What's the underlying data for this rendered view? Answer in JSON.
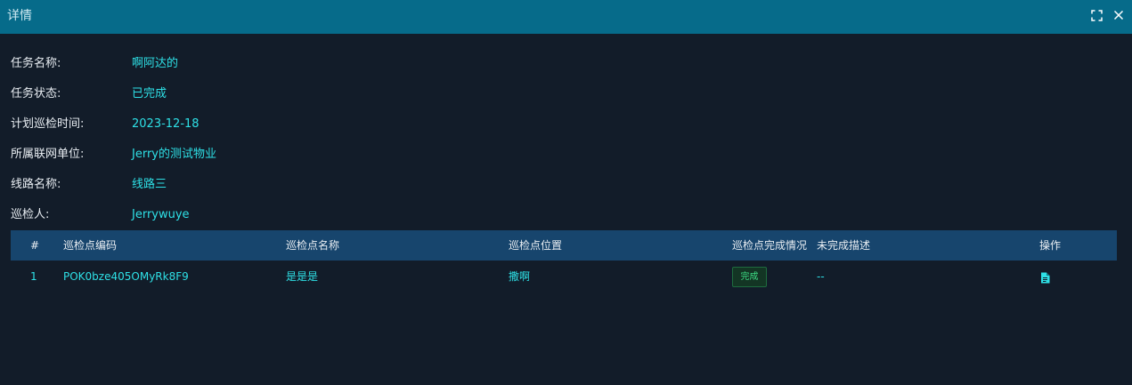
{
  "window": {
    "title": "详情",
    "icons": {
      "fullscreen": "fullscreen-icon",
      "close": "close-icon"
    }
  },
  "fields": [
    {
      "label": "任务名称:",
      "value": "啊阿达的"
    },
    {
      "label": "任务状态:",
      "value": "已完成"
    },
    {
      "label": "计划巡检时间:",
      "value": "2023-12-18"
    },
    {
      "label": "所属联网单位:",
      "value": "Jerry的测试物业"
    },
    {
      "label": "线路名称:",
      "value": "线路三"
    },
    {
      "label": "巡检人:",
      "value": "Jerrywuye"
    }
  ],
  "table": {
    "headers": [
      "#",
      "巡检点编码",
      "巡检点名称",
      "巡检点位置",
      "巡检点完成情况",
      "未完成描述",
      "操作"
    ],
    "rows": [
      {
        "index": "1",
        "code": "POK0bze405OMyRk8F9",
        "name": "是是是",
        "position": "撒啊",
        "status": "完成",
        "description": "--",
        "action_icon": "document-icon"
      }
    ]
  },
  "colors": {
    "titlebar": "#066b8a",
    "background": "#121c29",
    "table_header": "#17456d",
    "accent_text": "#2ee0e6",
    "badge_text": "#3ddc84"
  }
}
